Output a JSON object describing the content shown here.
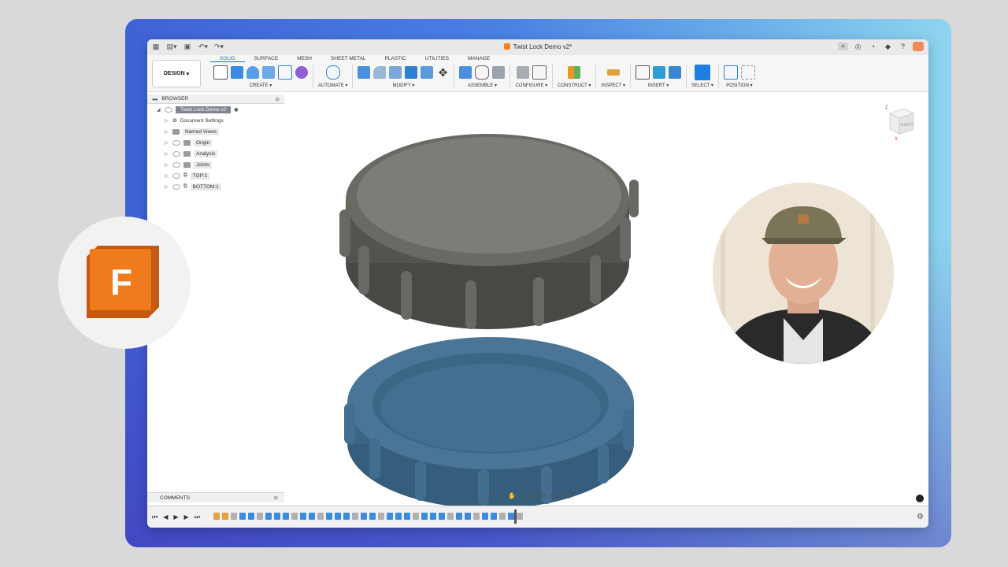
{
  "window": {
    "title": "Twist Lock Demo v2*"
  },
  "toolbar": {
    "workspace": "DESIGN",
    "tabs": [
      "SOLID",
      "SURFACE",
      "MESH",
      "SHEET METAL",
      "PLASTIC",
      "UTILITIES",
      "MANAGE"
    ],
    "groups": [
      "CREATE",
      "AUTOMATE",
      "MODIFY",
      "ASSEMBLE",
      "CONFIGURE",
      "CONSTRUCT",
      "INSPECT",
      "INSERT",
      "SELECT",
      "POSITION"
    ]
  },
  "browser": {
    "header": "BROWSER",
    "root": "Twist Lock Demo v2",
    "items": [
      "Document Settings",
      "Named Views",
      "Origin",
      "Analysis",
      "Joints",
      "TOP:1",
      "BOTTOM:1"
    ]
  },
  "comments": {
    "label": "COMMENTS"
  },
  "viewcube": {
    "face": "RIGHT",
    "axis_z": "Z",
    "axis_x": "X"
  },
  "logo": {
    "letter": "F"
  },
  "colors": {
    "accent": "#1a73c6",
    "top_part": "#5c5a55",
    "bottom_part": "#3e6a8c",
    "logo_orange": "#f07b1d"
  }
}
